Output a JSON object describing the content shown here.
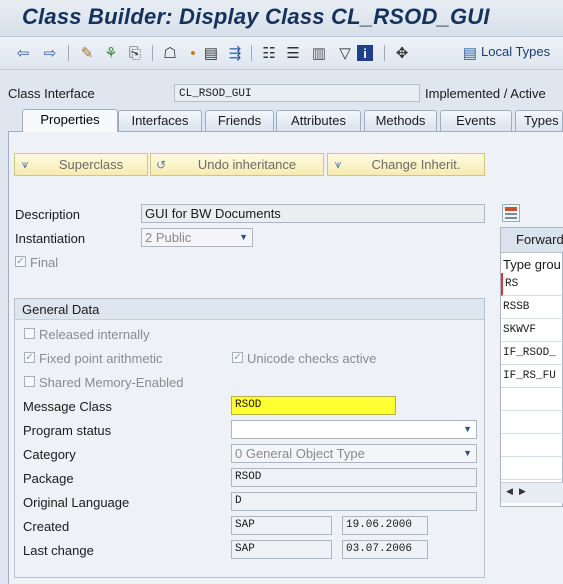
{
  "window": {
    "title": "Class Builder: Display Class CL_RSOD_GUI"
  },
  "toolbar": {
    "icons": [
      "back-icon",
      "forward-icon",
      "display-change-icon",
      "activate-icon",
      "other-object-icon",
      "hierarchy-icon",
      "where-used-icon",
      "object-list-icon",
      "navigation-icon",
      "inheritance-icon",
      "tree-icon",
      "sequence-icon",
      "filter-icon",
      "info-icon",
      "enhancement-icon",
      "local-types-icon"
    ],
    "local_types_label": "Local Types"
  },
  "header": {
    "class_interface_label": "Class Interface",
    "class_interface_value": "CL_RSOD_GUI",
    "status": "Implemented / Active"
  },
  "tabs": [
    {
      "label": "Properties",
      "active": true
    },
    {
      "label": "Interfaces"
    },
    {
      "label": "Friends"
    },
    {
      "label": "Attributes"
    },
    {
      "label": "Methods"
    },
    {
      "label": "Events"
    },
    {
      "label": "Types"
    }
  ],
  "buttons": {
    "superclass": "Superclass",
    "undo_inheritance": "Undo inheritance",
    "change_inherit": "Change Inherit."
  },
  "properties": {
    "description_label": "Description",
    "description_value": "GUI for BW Documents",
    "instantiation_label": "Instantiation",
    "instantiation_value": "2 Public",
    "final_label": "Final"
  },
  "general_data": {
    "title": "General Data",
    "released_internally": "Released internally",
    "fixed_point": "Fixed point arithmetic",
    "unicode_checks": "Unicode checks active",
    "shared_memory": "Shared Memory-Enabled",
    "message_class_label": "Message Class",
    "message_class_value": "RSOD",
    "program_status_label": "Program status",
    "program_status_value": "",
    "category_label": "Category",
    "category_value": "0 General Object Type",
    "package_label": "Package",
    "package_value": "RSOD",
    "original_language_label": "Original Language",
    "original_language_value": "D",
    "created_label": "Created",
    "created_by": "SAP",
    "created_on": "19.06.2000",
    "last_change_label": "Last change",
    "last_change_by": "SAP",
    "last_change_on": "03.07.2006"
  },
  "forward_panel": {
    "title": "Forward",
    "column_header": "Type grou",
    "rows": [
      "RS",
      "RSSB",
      "SKWVF",
      "IF_RSOD_",
      "IF_RS_FU"
    ]
  }
}
